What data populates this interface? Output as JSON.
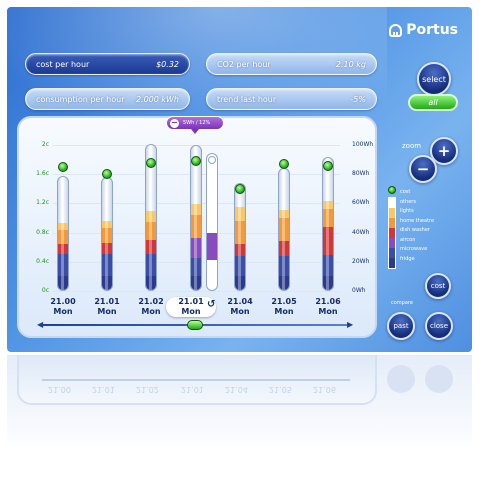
{
  "brand": {
    "name": "Portus"
  },
  "stats": {
    "cost_per_hour": {
      "label": "cost per hour",
      "value": "$0.32"
    },
    "co2_per_hour": {
      "label": "CO2 per hour",
      "value": "2.10 kg"
    },
    "consumption_per_hour": {
      "label": "consumption per hour",
      "value": "2.000 kWh"
    },
    "trend_last_hour": {
      "label": "trend last hour",
      "value": "-5%"
    }
  },
  "controls": {
    "select": "select",
    "all": "all",
    "zoom": "zoom",
    "zoom_in": "+",
    "zoom_out": "−",
    "cost": "cost",
    "compare": "compare",
    "past": "past",
    "close": "close"
  },
  "callout": {
    "text": "5Wh / 12%"
  },
  "axes": {
    "left_ticks": [
      "2c",
      "1.6c",
      "1.2c",
      "0.8c",
      "0.4c",
      "0c"
    ],
    "right_ticks": [
      "100Wh",
      "80Wh",
      "60Wh",
      "40Wh",
      "20Wh",
      "0Wh"
    ]
  },
  "legend": {
    "items": [
      "cost",
      "others",
      "lights",
      "home theatre",
      "dish washer",
      "aircon",
      "microwave",
      "fridge"
    ],
    "colors": [
      "#3dbb1e",
      "#ffffff",
      "#f7c86a",
      "#f19a3a",
      "#d23636",
      "#8a4bbf",
      "#3a4ea8",
      "#2a3a8e"
    ]
  },
  "chart_data": {
    "type": "bar",
    "categories": [
      {
        "date": "21.00",
        "day": "Mon"
      },
      {
        "date": "21.01",
        "day": "Mon"
      },
      {
        "date": "21.02",
        "day": "Mon"
      },
      {
        "date": "21.01",
        "day": "Mon"
      },
      {
        "date": "21.04",
        "day": "Mon"
      },
      {
        "date": "21.05",
        "day": "Mon"
      },
      {
        "date": "21.06",
        "day": "Mon"
      }
    ],
    "y_right_unit": "Wh",
    "y_right_range": [
      0,
      100
    ],
    "y_left_range": [
      0,
      2
    ],
    "stack_order": [
      "fridge",
      "microwave",
      "aircon",
      "dish washer",
      "home theatre",
      "lights",
      "others"
    ],
    "stacks": [
      [
        10,
        15,
        0,
        7,
        10,
        5,
        32
      ],
      [
        10,
        15,
        0,
        8,
        10,
        5,
        30
      ],
      [
        10,
        15,
        0,
        10,
        12,
        8,
        46
      ],
      [
        10,
        12,
        14,
        0,
        16,
        8,
        40
      ],
      [
        10,
        14,
        0,
        8,
        16,
        10,
        16
      ],
      [
        10,
        14,
        0,
        10,
        16,
        6,
        28
      ],
      [
        10,
        14,
        0,
        20,
        12,
        6,
        30
      ]
    ],
    "cost_points": [
      1.7,
      1.6,
      1.75,
      1.78,
      1.4,
      1.74,
      1.71
    ],
    "highlight": {
      "index": 3,
      "value_wh": 10,
      "hollow_point": 1.8,
      "label": "5Wh / 12%"
    }
  }
}
